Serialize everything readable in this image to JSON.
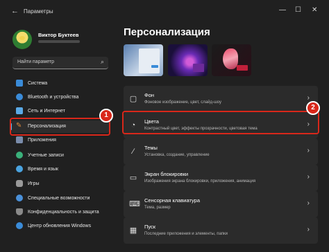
{
  "window": {
    "back_glyph": "←",
    "title": "Параметры",
    "minimize_glyph": "—",
    "maximize_glyph": "☐",
    "close_glyph": "✕"
  },
  "user": {
    "name": "Виктор Буктеев"
  },
  "search": {
    "placeholder": "Найти параметр",
    "icon_glyph": "⌕"
  },
  "sidebar": {
    "items": [
      {
        "label": "Система",
        "icon": "monitor-icon",
        "color": "#3a8bd8"
      },
      {
        "label": "Bluetooth и устройства",
        "icon": "bluetooth-icon",
        "color": "#3a8bd8"
      },
      {
        "label": "Сеть и Интернет",
        "icon": "wifi-icon",
        "color": "#5aa9e6"
      },
      {
        "label": "Персонализация",
        "icon": "brush-icon",
        "color": "#e08a3c"
      },
      {
        "label": "Приложения",
        "icon": "apps-icon",
        "color": "#7a8cab"
      },
      {
        "label": "Учетные записи",
        "icon": "account-icon",
        "color": "#3ab07a"
      },
      {
        "label": "Время и язык",
        "icon": "globe-clock-icon",
        "color": "#4aa3df"
      },
      {
        "label": "Игры",
        "icon": "gamepad-icon",
        "color": "#9a9a9a"
      },
      {
        "label": "Специальные возможности",
        "icon": "accessibility-icon",
        "color": "#4a90d9"
      },
      {
        "label": "Конфиденциальность и защита",
        "icon": "shield-icon",
        "color": "#8a8a8a"
      },
      {
        "label": "Центр обновления Windows",
        "icon": "update-icon",
        "color": "#3a8bd8"
      }
    ],
    "active_index": 3
  },
  "annotations": {
    "badge_1": "1",
    "badge_2": "2",
    "accent": "#d9271a"
  },
  "main": {
    "title": "Персонализация",
    "cards": [
      {
        "title": "Фон",
        "subtitle": "Фоновое изображение, цвет, слайд-шоу",
        "icon": "image-icon",
        "glyph": "▢"
      },
      {
        "title": "Цвета",
        "subtitle": "Контрастный цвет, эффекты прозрачности, цветовая тема",
        "icon": "palette-icon",
        "glyph": "◔"
      },
      {
        "title": "Темы",
        "subtitle": "Установка, создание, управление",
        "icon": "brush-icon",
        "glyph": "∕"
      },
      {
        "title": "Экран блокировки",
        "subtitle": "Изображения экрана блокировки, приложения, анимация",
        "icon": "lockscreen-icon",
        "glyph": "▭"
      },
      {
        "title": "Сенсорная клавиатура",
        "subtitle": "Тема, размер",
        "icon": "keyboard-icon",
        "glyph": "⌨"
      },
      {
        "title": "Пуск",
        "subtitle": "Последние приложения и элементы, папки",
        "icon": "start-icon",
        "glyph": "▦"
      }
    ],
    "chevron_glyph": "›"
  },
  "colors": {
    "accent_blue": "#4cc2ff",
    "card_bg": "#2b2b2b",
    "window_bg": "#202020"
  }
}
